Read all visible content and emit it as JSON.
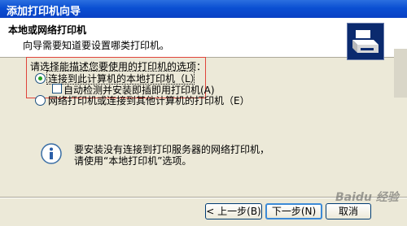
{
  "window": {
    "title": "添加打印机向导"
  },
  "header": {
    "title": "本地或网络打印机",
    "subtitle": "向导需要知道要设置哪类打印机。"
  },
  "icons": {
    "wizard": "printer-icon",
    "info": "info-icon"
  },
  "options": {
    "prompt": "请选择能描述您要使用的打印机的选项：",
    "local": {
      "label": "连接到此计算机的本地打印机（L）",
      "selected": true
    },
    "auto_detect": {
      "label": "自动检测并安装即插即用打印机(A)",
      "checked": false
    },
    "network": {
      "label": "网络打印机或连接到其他计算机的打印机（E）",
      "selected": false
    }
  },
  "info": {
    "line1": "要安装没有连接到打印服务器的网络打印机，",
    "line2": "请使用“本地打印机”选项。"
  },
  "buttons": {
    "back": "< 上一步(B)",
    "next": "下一步(N)",
    "cancel": "取消"
  },
  "watermark": "Baidu 经验",
  "colors": {
    "titlebar": "#0a4fd2",
    "highlight_box": "#e0443a",
    "radio_selected": "#22a022"
  }
}
